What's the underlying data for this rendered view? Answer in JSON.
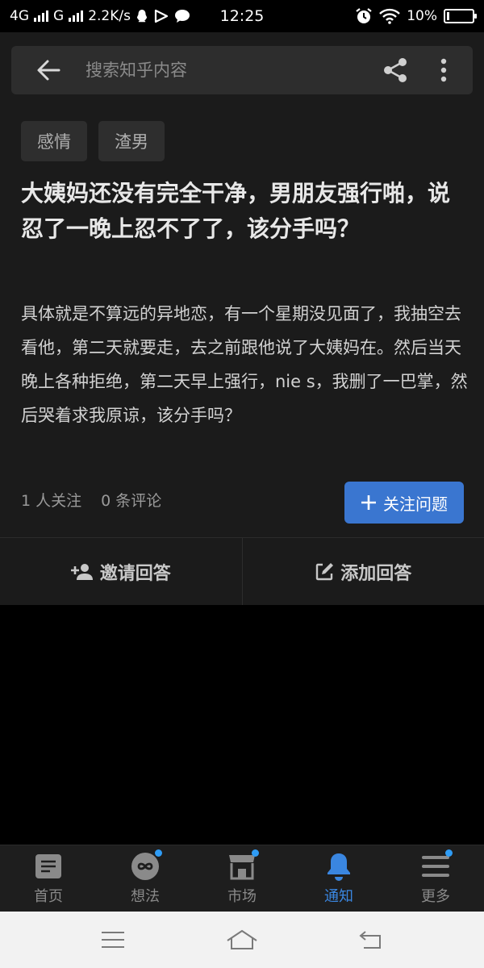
{
  "status": {
    "net1": "4G",
    "net2": "G",
    "speed": "2.2K/s",
    "time": "12:25",
    "battery": "10%",
    "battery_level": 0.1
  },
  "header": {
    "search_placeholder": "搜索知乎内容",
    "icons": [
      "arrow-left-icon",
      "share-icon",
      "more-vertical-icon"
    ]
  },
  "question": {
    "tags": [
      "感情",
      "渣男"
    ],
    "title": "大姨妈还没有完全干净，男朋友强行啪，说忍了一晚上忍不了了，该分手吗？",
    "body": "具体就是不算远的异地恋，有一个星期没见面了，我抽空去看他，第二天就要走，去之前跟他说了大姨妈在。然后当天晚上各种拒绝，第二天早上强行，nie s，我删了一巴掌，然后哭着求我原谅，该分手吗？",
    "followers": "1 人关注",
    "comments": "0 条评论",
    "follow_label": "关注问题"
  },
  "actions": {
    "invite_label": "邀请回答",
    "add_label": "添加回答"
  },
  "bottom_nav": {
    "items": [
      {
        "label": "首页",
        "icon": "home-doc-icon",
        "dot": false
      },
      {
        "label": "想法",
        "icon": "ideas-icon",
        "dot": true
      },
      {
        "label": "市场",
        "icon": "market-icon",
        "dot": true
      },
      {
        "label": "通知",
        "icon": "bell-icon",
        "dot": false,
        "active": true
      },
      {
        "label": "更多",
        "icon": "menu-icon",
        "dot": true
      }
    ],
    "accent": "#3a86e0"
  },
  "colors": {
    "follow_button": "#3a76d0",
    "background": "#1b1b1b"
  }
}
